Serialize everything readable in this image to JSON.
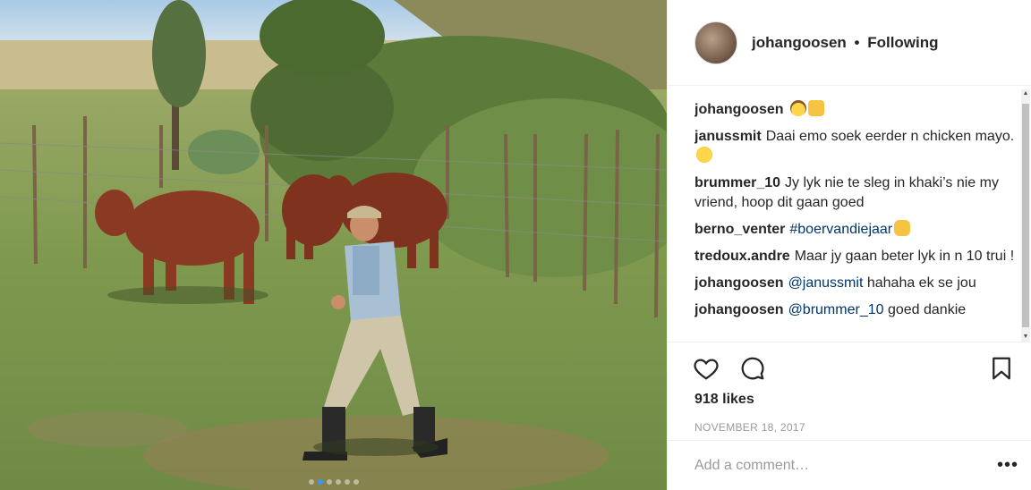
{
  "photo": {
    "carousel_count": 6,
    "active_index": 1
  },
  "header": {
    "username": "johangoosen",
    "separator": "•",
    "follow_status": "Following"
  },
  "comments": [
    {
      "user": "johangoosen",
      "parts": [],
      "emojis": [
        "cowboy",
        "thumbs-up"
      ]
    },
    {
      "user": "janussmit",
      "text": "Daai emo soek eerder n chicken mayo.",
      "emojis": [
        "laughing"
      ]
    },
    {
      "user": "brummer_10",
      "text": "Jy lyk nie te sleg in khaki’s nie my vriend, hoop dit gaan goed"
    },
    {
      "user": "berno_venter",
      "tag": "#boervandiejaar",
      "emojis": [
        "ok-hand"
      ]
    },
    {
      "user": "tredoux.andre",
      "text": "Maar jy gaan beter lyk in n 10 trui !"
    },
    {
      "user": "johangoosen",
      "mention": "@janussmit",
      "text": "hahaha ek se jou"
    },
    {
      "user": "johangoosen",
      "mention": "@brummer_10",
      "text": "goed dankie"
    }
  ],
  "actions": {
    "like_icon": "heart-icon",
    "comment_icon": "comment-icon",
    "save_icon": "bookmark-icon"
  },
  "likes": "918 likes",
  "date": "NOVEMBER 18, 2017",
  "add_comment": {
    "placeholder": "Add a comment…",
    "more_label": "•••"
  },
  "colors": {
    "link": "#003569",
    "active_dot": "#3897f0",
    "muted": "#999999"
  }
}
